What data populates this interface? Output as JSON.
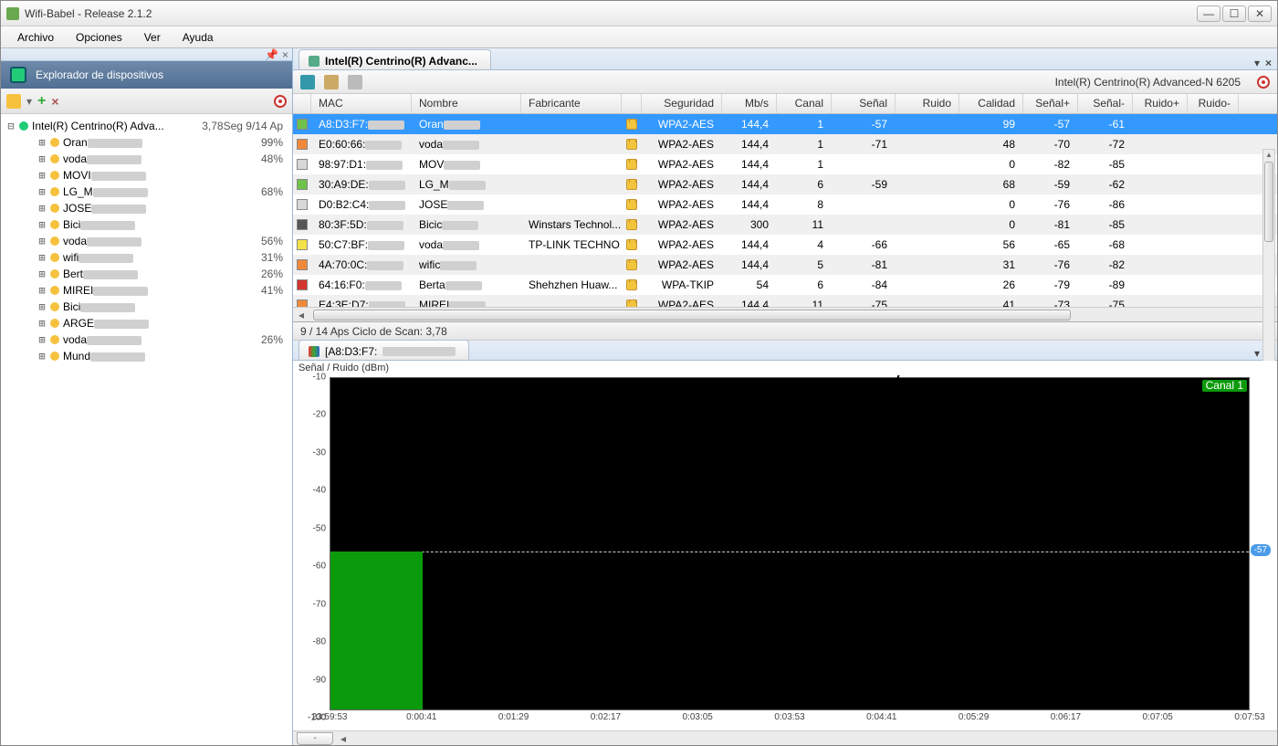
{
  "window": {
    "title": "Wifi-Babel - Release 2.1.2"
  },
  "menu": {
    "file": "Archivo",
    "options": "Opciones",
    "view": "Ver",
    "help": "Ayuda"
  },
  "sidebar": {
    "pin": "📌",
    "close": "×",
    "title": "Explorador de dispositivos",
    "root": {
      "label": "Intel(R) Centrino(R) Adva...",
      "right": "3,78Seg 9/14 Ap"
    },
    "items": [
      {
        "label": "Oran",
        "pct": "99%"
      },
      {
        "label": "voda",
        "pct": "48%"
      },
      {
        "label": "MOVI",
        "pct": ""
      },
      {
        "label": "LG_M",
        "pct": "68%"
      },
      {
        "label": "JOSE",
        "pct": ""
      },
      {
        "label": "Bici",
        "pct": ""
      },
      {
        "label": "voda",
        "pct": "56%"
      },
      {
        "label": "wifi",
        "pct": "31%"
      },
      {
        "label": "Bert",
        "pct": "26%"
      },
      {
        "label": "MIREI",
        "pct": "41%"
      },
      {
        "label": "Bici",
        "pct": ""
      },
      {
        "label": "ARGE",
        "pct": ""
      },
      {
        "label": "voda",
        "pct": "26%"
      },
      {
        "label": "Mund",
        "pct": ""
      }
    ]
  },
  "main": {
    "tab_label": "Intel(R) Centrino(R) Advanc...",
    "adapter_label": "Intel(R) Centrino(R) Advanced-N 6205",
    "headers": {
      "mac": "MAC",
      "name": "Nombre",
      "fab": "Fabricante",
      "sec": "Seguridad",
      "mbs": "Mb/s",
      "ch": "Canal",
      "sig": "Señal",
      "noise": "Ruido",
      "qual": "Calidad",
      "sigp": "Señal+",
      "sigm": "Señal-",
      "noisep": "Ruido+",
      "noisem": "Ruido-"
    },
    "rows": [
      {
        "color": "#6fc24a",
        "mac": "A8:D3:F7:",
        "name": "Oran",
        "fab": "",
        "sec": "WPA2-AES",
        "mbs": "144,4",
        "ch": "1",
        "sig": "-57",
        "noise": "",
        "qual": "99",
        "sigp": "-57",
        "sigm": "-61",
        "sel": true
      },
      {
        "color": "#f08a3a",
        "mac": "E0:60:66:",
        "name": "voda",
        "fab": "",
        "sec": "WPA2-AES",
        "mbs": "144,4",
        "ch": "1",
        "sig": "-71",
        "noise": "",
        "qual": "48",
        "sigp": "-70",
        "sigm": "-72",
        "alt": true
      },
      {
        "color": "#d7d7d7",
        "mac": "98:97:D1:",
        "name": "MOV",
        "fab": "",
        "sec": "WPA2-AES",
        "mbs": "144,4",
        "ch": "1",
        "sig": "",
        "noise": "",
        "qual": "0",
        "sigp": "-82",
        "sigm": "-85"
      },
      {
        "color": "#6fc24a",
        "mac": "30:A9:DE:",
        "name": "LG_M",
        "fab": "",
        "sec": "WPA2-AES",
        "mbs": "144,4",
        "ch": "6",
        "sig": "-59",
        "noise": "",
        "qual": "68",
        "sigp": "-59",
        "sigm": "-62",
        "alt": true
      },
      {
        "color": "#d7d7d7",
        "mac": "D0:B2:C4:",
        "name": "JOSE",
        "fab": "",
        "sec": "WPA2-AES",
        "mbs": "144,4",
        "ch": "8",
        "sig": "",
        "noise": "",
        "qual": "0",
        "sigp": "-76",
        "sigm": "-86"
      },
      {
        "color": "#555555",
        "mac": "80:3F:5D:",
        "name": "Bicic",
        "fab": "Winstars Technol...",
        "sec": "WPA2-AES",
        "mbs": "300",
        "ch": "11",
        "sig": "",
        "noise": "",
        "qual": "0",
        "sigp": "-81",
        "sigm": "-85",
        "alt": true
      },
      {
        "color": "#f4e24a",
        "mac": "50:C7:BF:",
        "name": "voda",
        "fab": "TP-LINK TECHNO...",
        "sec": "WPA2-AES",
        "mbs": "144,4",
        "ch": "4",
        "sig": "-66",
        "noise": "",
        "qual": "56",
        "sigp": "-65",
        "sigm": "-68"
      },
      {
        "color": "#f08a3a",
        "mac": "4A:70:0C:",
        "name": "wific",
        "fab": "",
        "sec": "WPA2-AES",
        "mbs": "144,4",
        "ch": "5",
        "sig": "-81",
        "noise": "",
        "qual": "31",
        "sigp": "-76",
        "sigm": "-82",
        "alt": true
      },
      {
        "color": "#d4342e",
        "mac": "64:16:F0:",
        "name": "Berta",
        "fab": "Shehzhen Huaw...",
        "sec": "WPA-TKIP",
        "mbs": "54",
        "ch": "6",
        "sig": "-84",
        "noise": "",
        "qual": "26",
        "sigp": "-79",
        "sigm": "-89"
      },
      {
        "color": "#f08a3a",
        "mac": "E4:3E:D7:",
        "name": "MIREI",
        "fab": "",
        "sec": "WPA2-AES",
        "mbs": "144,4",
        "ch": "11",
        "sig": "-75",
        "noise": "",
        "qual": "41",
        "sigp": "-73",
        "sigm": "-75",
        "alt": true
      }
    ],
    "status": "9 / 14 Aps     Ciclo de Scan: 3,78"
  },
  "chart": {
    "tab_label": "[A8:D3:F7:",
    "title": "Señal / Ruido (dBm)",
    "canal_badge": "Canal\n1",
    "current_badge": "-57"
  },
  "chart_data": {
    "type": "area",
    "title": "Señal / Ruido (dBm)",
    "xlabel": "",
    "ylabel": "dBm",
    "ylim": [
      -100,
      -10
    ],
    "yticks": [
      -10,
      -20,
      -30,
      -40,
      -50,
      -60,
      -70,
      -80,
      -90,
      -100
    ],
    "xticks": [
      "23:59:53",
      "0:00:41",
      "0:01:29",
      "0:02:17",
      "0:03:05",
      "0:03:53",
      "0:04:41",
      "0:05:29",
      "0:06:17",
      "0:07:05",
      "0:07:53"
    ],
    "series": [
      {
        "name": "Señal",
        "color": "#0b9a0b",
        "x": [
          "23:59:53",
          "0:00:41"
        ],
        "values": [
          -57,
          -57
        ]
      }
    ],
    "reference_line": -57
  }
}
